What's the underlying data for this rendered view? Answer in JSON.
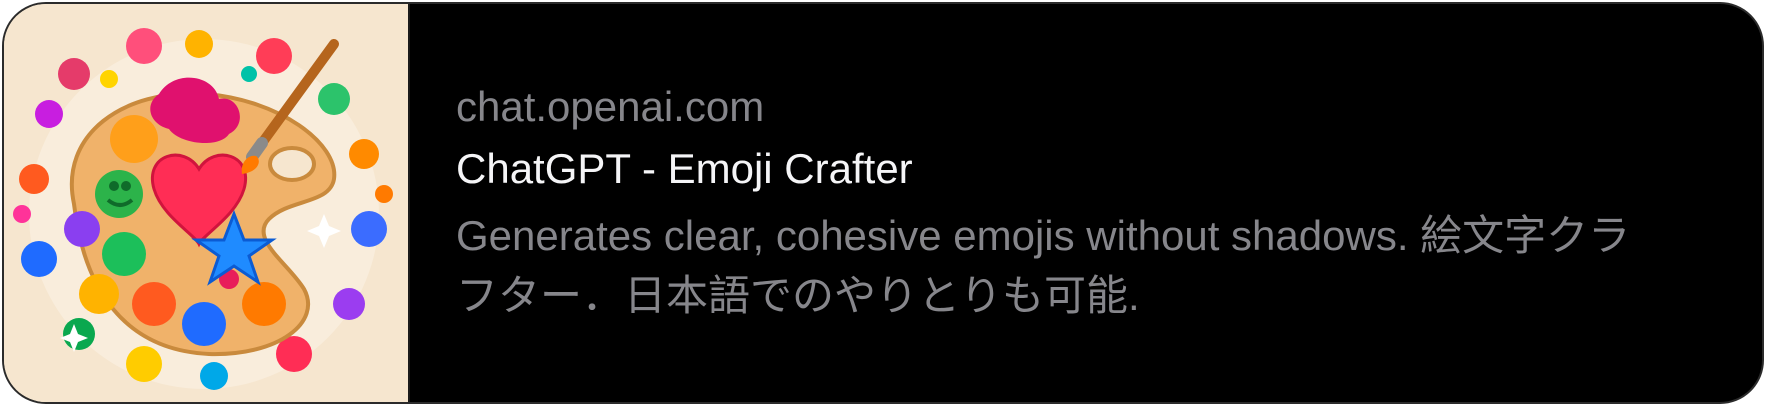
{
  "link_preview": {
    "domain": "chat.openai.com",
    "title": "ChatGPT - Emoji Crafter",
    "description": "Generates clear, cohesive emojis without shadows. 絵文字クラフター．日本語でのやりとりも可能.",
    "thumbnail_icon": "paint-palette-emoji-icon"
  },
  "colors": {
    "card_background": "#000000",
    "title_text": "#f5f5f7",
    "secondary_text": "#86868b",
    "thumbnail_background": "#f6e6cf"
  }
}
